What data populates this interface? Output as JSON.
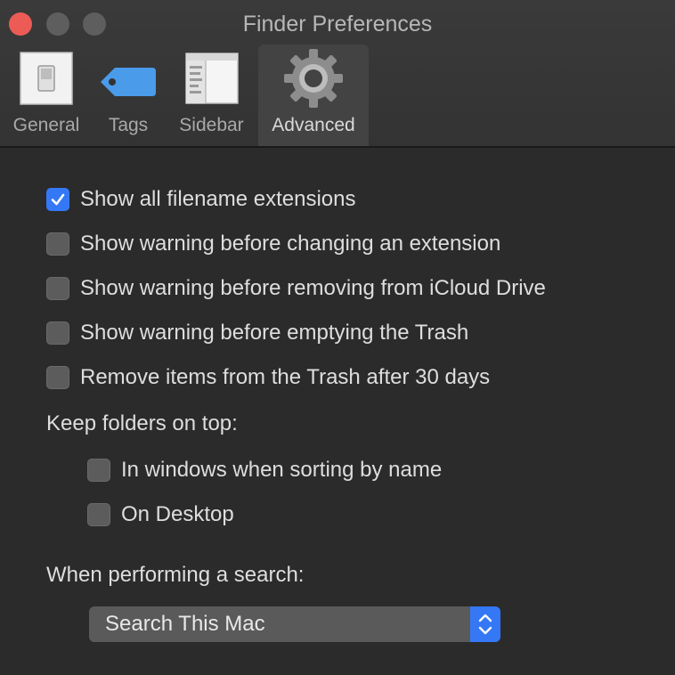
{
  "window": {
    "title": "Finder Preferences"
  },
  "toolbar": {
    "tabs": [
      {
        "id": "general",
        "label": "General",
        "icon": "switch-icon"
      },
      {
        "id": "tags",
        "label": "Tags",
        "icon": "tag-icon"
      },
      {
        "id": "sidebar",
        "label": "Sidebar",
        "icon": "sidebar-icon"
      },
      {
        "id": "advanced",
        "label": "Advanced",
        "icon": "gear-icon",
        "selected": true
      }
    ]
  },
  "options": [
    {
      "label": "Show all filename extensions",
      "checked": true
    },
    {
      "label": "Show warning before changing an extension",
      "checked": false
    },
    {
      "label": "Show warning before removing from iCloud Drive",
      "checked": false
    },
    {
      "label": "Show warning before emptying the Trash",
      "checked": false
    },
    {
      "label": "Remove items from the Trash after 30 days",
      "checked": false
    }
  ],
  "keep_folders": {
    "heading": "Keep folders on top:",
    "options": [
      {
        "label": "In windows when sorting by name",
        "checked": false
      },
      {
        "label": "On Desktop",
        "checked": false
      }
    ]
  },
  "search": {
    "heading": "When performing a search:",
    "selected": "Search This Mac"
  },
  "colors": {
    "accent": "#3478f6",
    "close": "#ec5b56"
  }
}
